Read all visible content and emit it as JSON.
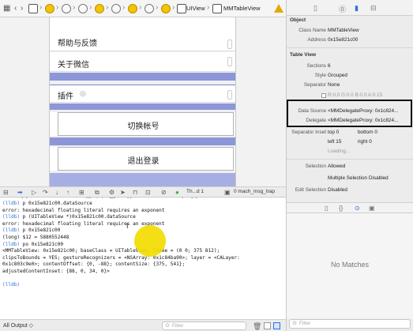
{
  "jumpbar": {
    "back_icon": "chevron-left-icon",
    "forward_icon": "chevron-right-icon",
    "crumb_uiview": "UIView",
    "crumb_tableview": "MMTableView",
    "warn_icon": "warning-triangle-icon"
  },
  "table": {
    "row1": "帮助与反馈",
    "row2": "关于微信",
    "row3": "插件",
    "switch_account": "切换帐号",
    "logout": "退出登录"
  },
  "debugbar": {
    "thread_label": "Th...d 1",
    "frame_label": "0 mach_msg_trap"
  },
  "console": {
    "lines": [
      {
        "t": "(lldb) p 0x15e821c00.dataSource",
        "prompt": true
      },
      {
        "t": "error: hexadecimal floating literal requires an exponent",
        "prompt": false
      },
      {
        "t": "(lldb) p (UITableView *)0x15e821c00.dataSource",
        "prompt": true
      },
      {
        "t": "error: hexadecimal floating literal requires an exponent",
        "prompt": false
      },
      {
        "t": "(lldb) p 0x15e821c00",
        "prompt": true
      },
      {
        "t": "(long) $12 = 5880552448",
        "prompt": false
      },
      {
        "t": "(lldb) po 0x15e821c00",
        "prompt": true
      },
      {
        "t": "<MMTableView: 0x15e821c00; baseClass = UITableView; frame = (0 0; 375 812);",
        "prompt": false
      },
      {
        "t": "clipsToBounds = YES; gestureRecognizers = <NSArray: 0x1c84ba90>; layer = <CALayer:",
        "prompt": false
      },
      {
        "t": "0x1c803c9e0>; contentOffset: {0, -88}; contentSize: {375, 541};",
        "prompt": false
      },
      {
        "t": "adjustedContentInset: {88, 0, 34, 0}>",
        "prompt": false
      },
      {
        "t": "",
        "prompt": false
      },
      {
        "t": "(lldb)",
        "prompt": true
      }
    ]
  },
  "status": {
    "output_select": "All Output ◇",
    "filter_placeholder": "Filter"
  },
  "inspector": {
    "object_title": "Object",
    "class_name_label": "Class Name",
    "class_name_value": "MMTableView",
    "address_label": "Address",
    "address_value": "0x15e821c00",
    "tableview_title": "Table View",
    "sections_label": "Sections",
    "sections_value": "6",
    "style_label": "Style",
    "style_value": "Grouped",
    "separator_label": "Separator",
    "separator_value": "None",
    "separator_color": "R:0.0 G:0.0 B:0.0 A:0.15",
    "datasource_label": "Data Source",
    "datasource_value": "<MMDelegateProxy: 0x1c824...",
    "delegate_label": "Delegate",
    "delegate_value": "<MMDelegateProxy: 0x1c824...",
    "sep_inset_label": "Separator Inset",
    "inset_top": "top 0",
    "inset_bottom": "bottom 0",
    "inset_left": "left 15",
    "inset_right": "right 0",
    "loading": "Loading...",
    "selection_label": "Selection",
    "selection_value": "Allowed",
    "multi_sel_value": "Multiple Selection Disabled",
    "edit_sel_label": "Edit Selection",
    "edit_sel_value": "Disabled",
    "no_matches": "No Matches",
    "filter_placeholder": "Filter"
  }
}
